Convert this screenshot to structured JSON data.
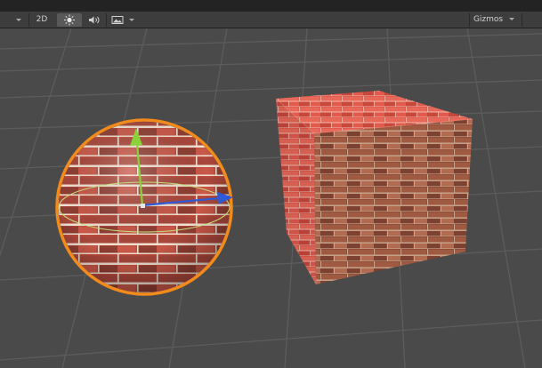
{
  "scene_toolbar": {
    "mode_2d_label": "2D",
    "gizmos_label": "Gizmos",
    "icons": {
      "left_dropdown": "caret-down-icon",
      "lighting": "sun-icon",
      "audio": "speaker-icon",
      "effects": "image-icon",
      "effects_dropdown": "caret-down-icon",
      "gizmos_dropdown": "caret-down-icon"
    }
  },
  "scene": {
    "objects": [
      "sphere",
      "cube"
    ],
    "material": "red-brick",
    "selection_outline_color": "#f28a1c",
    "gizmo_colors": {
      "y_axis": "#8ad23a",
      "x_axis": "#2f5ad6",
      "rotation_ring": "#c6e07a"
    },
    "background_color": "#4a4a4a",
    "grid_color": "#5a5a5a"
  }
}
